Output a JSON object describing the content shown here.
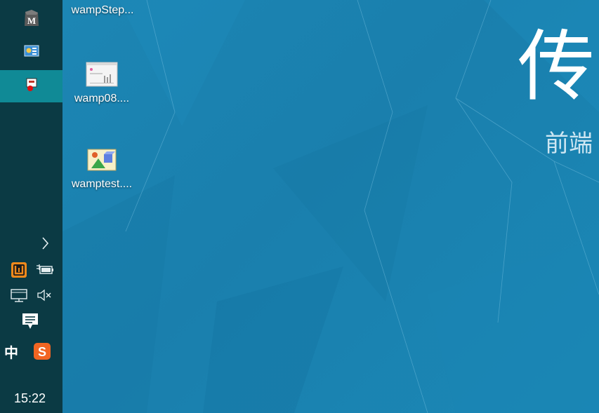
{
  "taskbar": {
    "apps": [
      {
        "name": "app-m",
        "icon": "m-app-icon"
      },
      {
        "name": "app-control",
        "icon": "control-panel-icon"
      },
      {
        "name": "app-remote",
        "icon": "remote-app-icon",
        "active": true
      }
    ],
    "tray": {
      "chevron": "›",
      "ime_label": "中",
      "sogou_label": "S"
    },
    "clock": "15:22"
  },
  "desktop": {
    "icons": [
      {
        "label": "wampStep...",
        "icon": "wamp-step-icon"
      },
      {
        "label": "wamp08....",
        "icon": "document-chart-icon"
      },
      {
        "label": "wamptest....",
        "icon": "image-file-icon"
      }
    ],
    "wallpaper": {
      "title": "传",
      "subtitle": "前端"
    }
  }
}
